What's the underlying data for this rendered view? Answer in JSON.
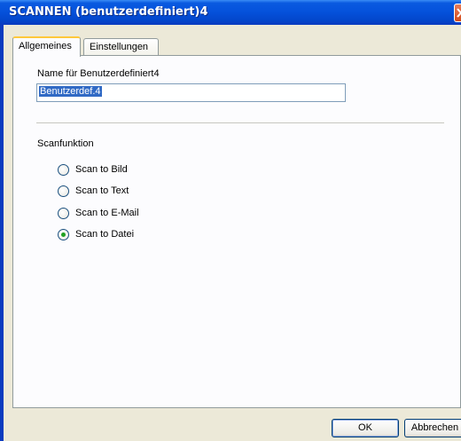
{
  "window": {
    "title": "SCANNEN (benutzerdefiniert)4"
  },
  "tabs": [
    {
      "label": "Allgemeines",
      "active": true
    },
    {
      "label": "Einstellungen",
      "active": false
    }
  ],
  "name_section": {
    "label": "Name für Benutzerdefiniert4",
    "value": "Benutzerdef.4"
  },
  "scan_function": {
    "label": "Scanfunktion",
    "options": [
      {
        "label": "Scan to Bild",
        "checked": false
      },
      {
        "label": "Scan to Text",
        "checked": false
      },
      {
        "label": "Scan to E-Mail",
        "checked": false
      },
      {
        "label": "Scan to Datei",
        "checked": true
      }
    ]
  },
  "buttons": {
    "ok": "OK",
    "cancel": "Abbrechen"
  },
  "colors": {
    "titlebar": "#0552dc",
    "dialog_bg": "#ece9d8",
    "selection": "#316ac5",
    "radio_dot": "#21a121"
  }
}
